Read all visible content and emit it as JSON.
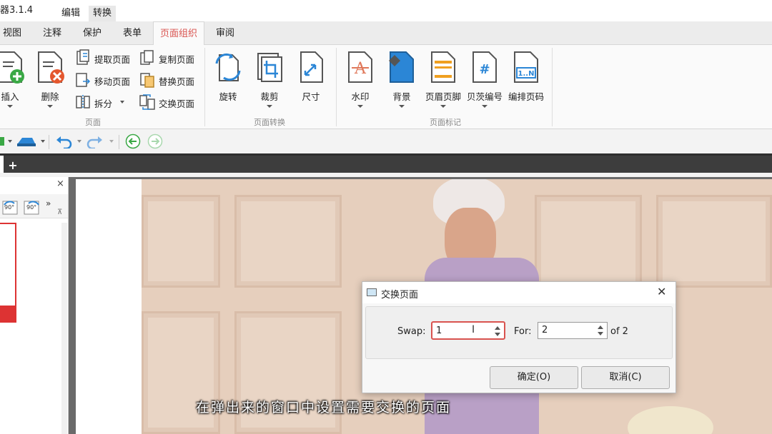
{
  "app": {
    "title": "器3.1.4"
  },
  "top_menu": [
    "编辑",
    "转换"
  ],
  "ribbon_tabs": [
    "视图",
    "注释",
    "保护",
    "表单",
    "页面组织",
    "审阅"
  ],
  "active_tab": "页面组织",
  "groups": {
    "page": {
      "label": "页面",
      "insert": "插入",
      "delete": "删除",
      "extract": "提取页面",
      "move": "移动页面",
      "split": "拆分",
      "copy": "复制页面",
      "replace": "替换页面",
      "swap": "交换页面"
    },
    "transform": {
      "label": "页面转换",
      "rotate": "旋转",
      "crop": "裁剪",
      "size": "尺寸"
    },
    "marks": {
      "label": "页面标记",
      "watermark": "水印",
      "background": "背景",
      "header_footer": "页眉页脚",
      "bates": "贝茨编号",
      "page_number": "编排页码"
    }
  },
  "sidepanel": {
    "rotate_left": "90°",
    "rotate_right": "90°"
  },
  "dialog": {
    "title": "交换页面",
    "swap_label": "Swap:",
    "swap_value": "1",
    "for_label": "For:",
    "for_value": "2",
    "of_text": "of 2",
    "ok": "确定(O)",
    "cancel": "取消(C)"
  },
  "caption": "在弹出来的窗口中设置需要交换的页面",
  "colors": {
    "accent": "#d9534f",
    "ribbon_blue": "#2b86d6"
  }
}
